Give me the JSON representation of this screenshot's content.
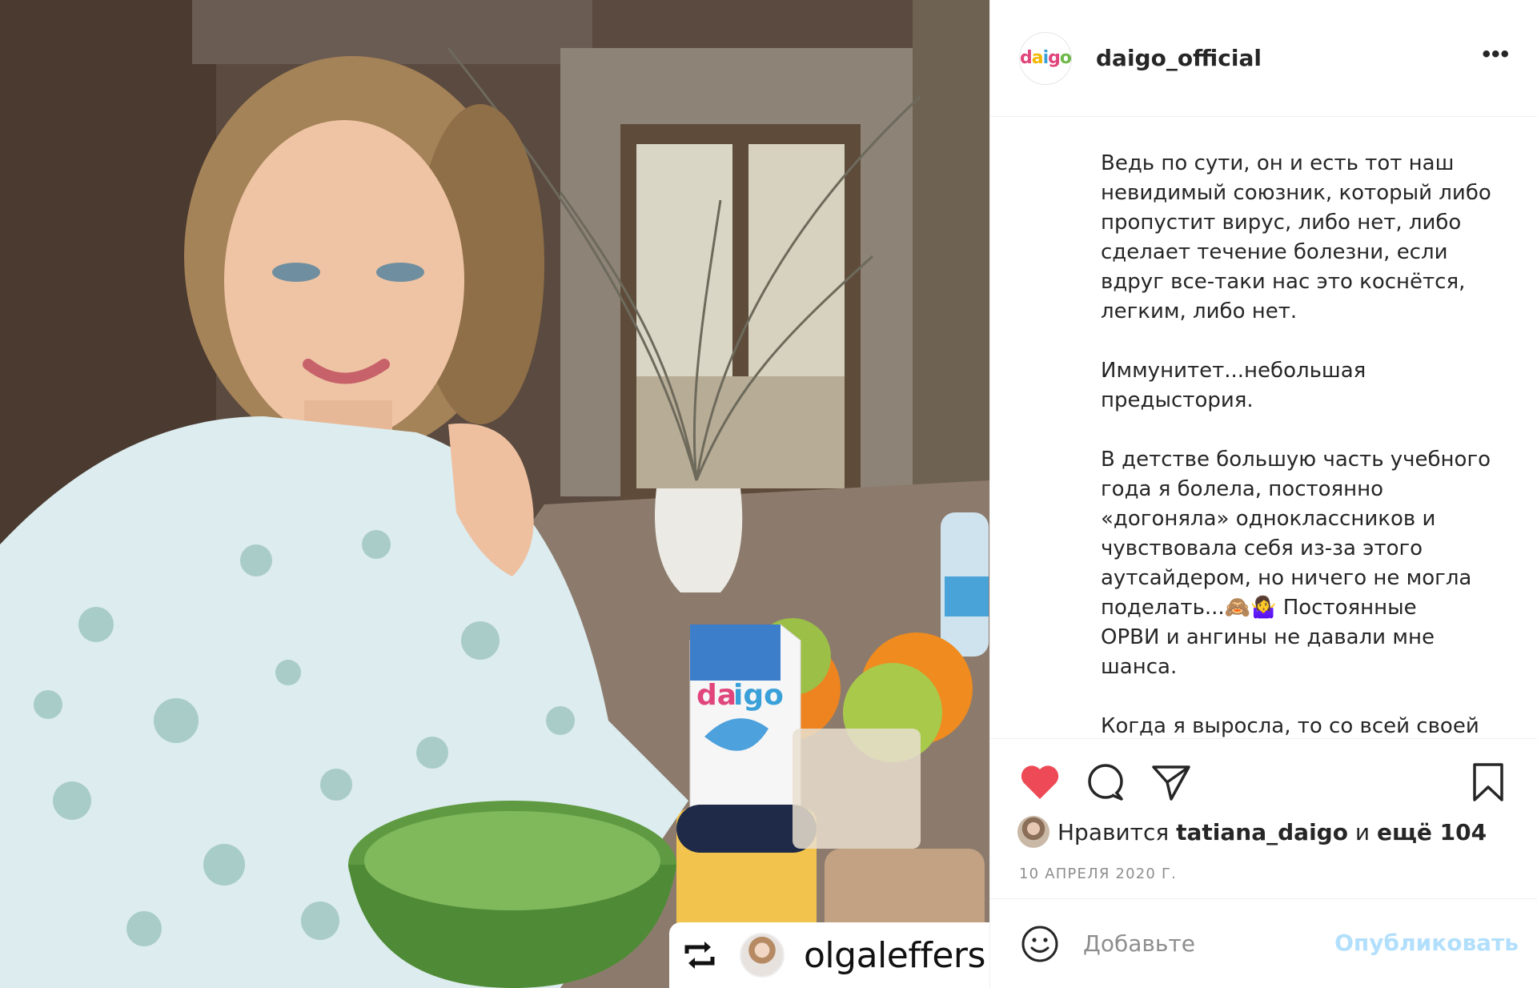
{
  "post": {
    "username": "daigo_official",
    "avatar_logo": "daigo",
    "more_label": "•••"
  },
  "caption": {
    "paragraphs": [
      "Ведь по сути, он и есть тот наш\nневидимый союзник, который либо\nпропустит вирус, либо нет, либо\nсделает течение болезни, если\nвдруг все-таки нас это коснётся,\nлегким, либо нет.",
      "Иммунитет...небольшая\nпредыстория.",
      "В детстве большую часть учебного\nгода я болела, постоянно\n«догоняла» одноклассников и\nчувствовала себя из-за этого\nаутсайдером, но ничего не могла\nподелать...🙈🤷‍♀️ Постоянные\nОРВИ и ангины не давали мне\nшанса.",
      "Когда я выросла, то со всей своей"
    ]
  },
  "actions": {
    "like_icon": "heart-icon",
    "comment_icon": "comment-icon",
    "share_icon": "paper-plane-icon",
    "save_icon": "bookmark-icon",
    "liked_color": "#ed4956"
  },
  "likes": {
    "prefix": "Нравится",
    "user": "tatiana_daigo",
    "connector": "и",
    "others": "ещё 104"
  },
  "date": "10 АПРЕЛЯ 2020 Г.",
  "comment": {
    "placeholder": "Добавьте",
    "publish_label": "Опубликовать",
    "publish_color": "#b2dffc"
  },
  "repost": {
    "username": "olgaleffers",
    "icon": "repost-icon"
  },
  "product": {
    "brand": "daigo"
  }
}
